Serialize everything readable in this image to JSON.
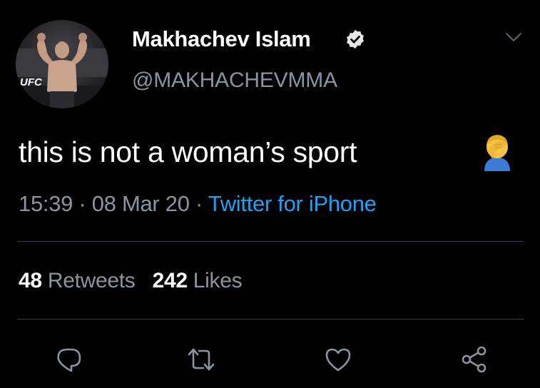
{
  "author": {
    "name": "Makhachev Islam",
    "handle": "@MAKHACHEVMMA",
    "avatar_logo_text": "UFC",
    "verified_icon": "verified-badge-icon"
  },
  "tweet": {
    "text": "this is not a woman’s sport",
    "emoji": "person-facepalming-emoji"
  },
  "meta": {
    "time": "15:39",
    "separator": "·",
    "date": "08 Mar 20",
    "source": "Twitter for iPhone"
  },
  "stats": {
    "retweets_count": "48",
    "retweets_label": "Retweets",
    "likes_count": "242",
    "likes_label": "Likes"
  },
  "actions": [
    {
      "name": "reply",
      "icon": "reply-icon"
    },
    {
      "name": "retweet",
      "icon": "retweet-icon"
    },
    {
      "name": "like",
      "icon": "heart-icon"
    },
    {
      "name": "share",
      "icon": "share-icon"
    }
  ],
  "colors": {
    "background": "#000000",
    "text": "#ffffff",
    "muted": "#8a959f",
    "link": "#1da1f2",
    "divider": "#38444d"
  }
}
